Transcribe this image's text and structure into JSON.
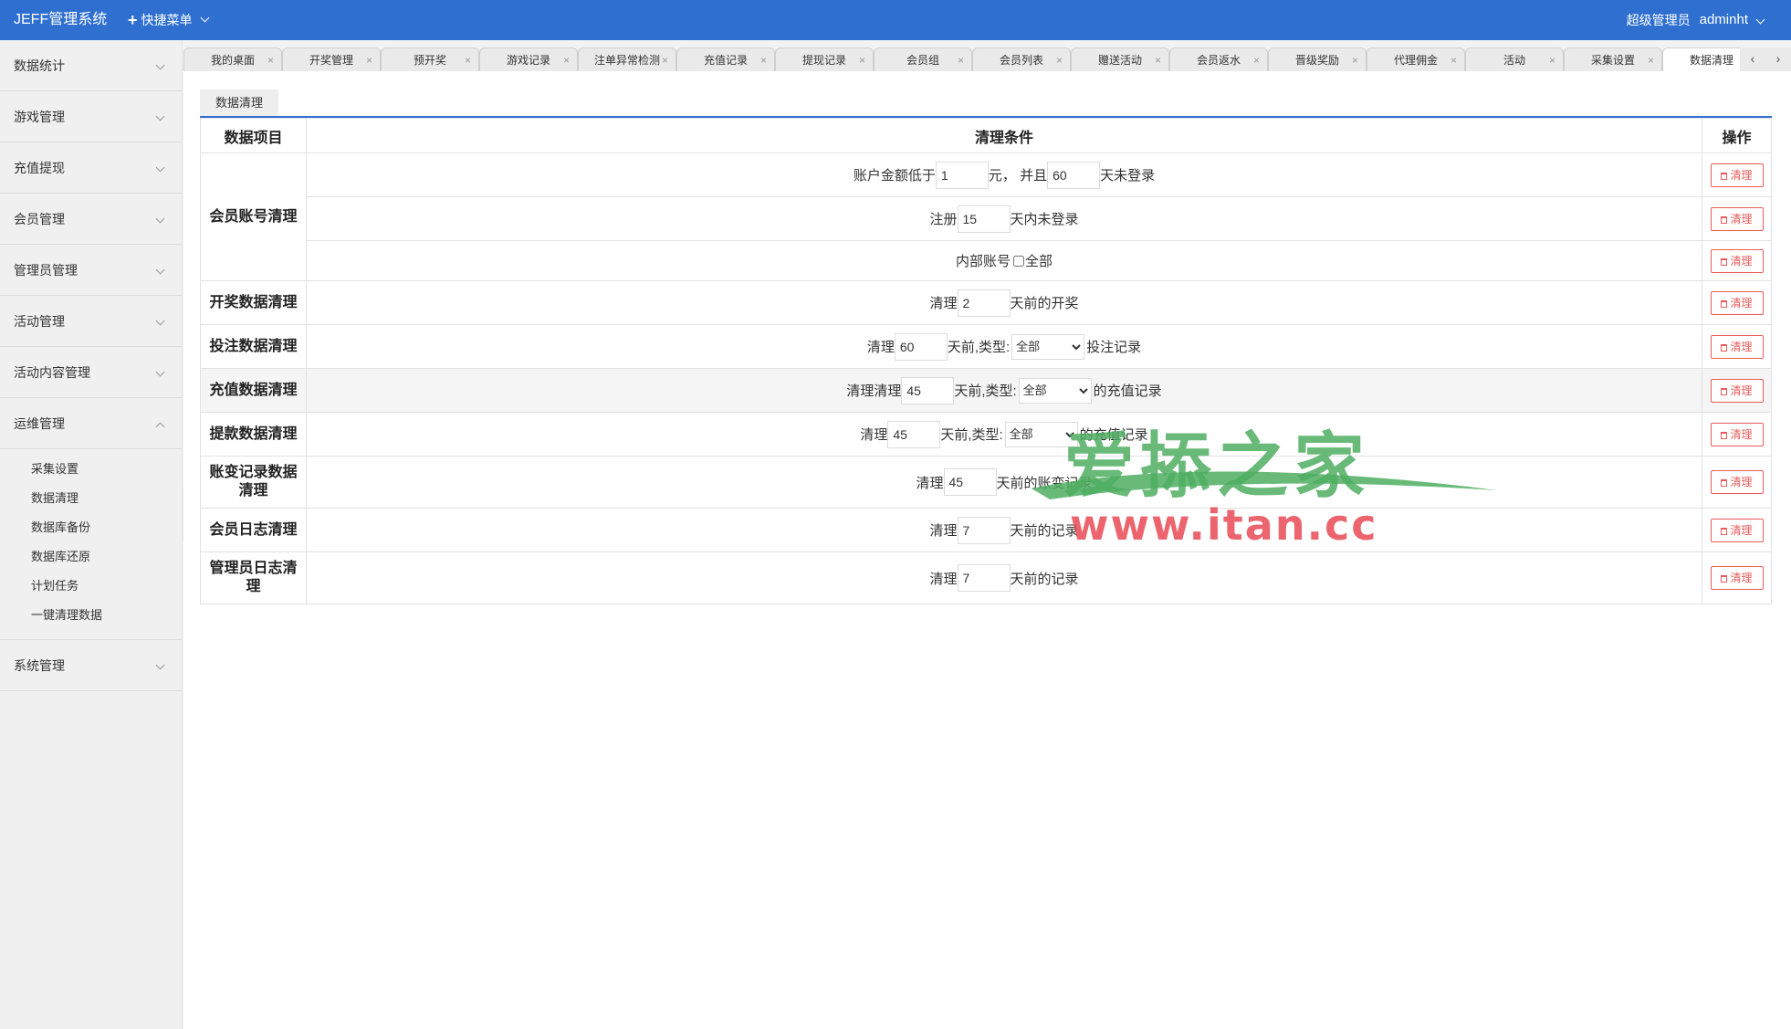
{
  "header": {
    "brand": "JEFF管理系统",
    "quick_menu": "快捷菜单",
    "role": "超级管理员",
    "username": "adminht"
  },
  "sidebar": {
    "groups": [
      {
        "label": "数据统计"
      },
      {
        "label": "游戏管理"
      },
      {
        "label": "充值提现"
      },
      {
        "label": "会员管理"
      },
      {
        "label": "管理员管理"
      },
      {
        "label": "活动管理"
      },
      {
        "label": "活动内容管理"
      },
      {
        "label": "运维管理",
        "open": true
      },
      {
        "label": "系统管理"
      }
    ],
    "ops_sub_items": [
      "采集设置",
      "数据清理",
      "数据库备份",
      "数据库还原",
      "计划任务",
      "一键清理数据"
    ]
  },
  "tabs": [
    {
      "label": "我的桌面"
    },
    {
      "label": "开奖管理"
    },
    {
      "label": "预开奖"
    },
    {
      "label": "游戏记录"
    },
    {
      "label": "注单异常检测"
    },
    {
      "label": "充值记录"
    },
    {
      "label": "提现记录"
    },
    {
      "label": "会员组"
    },
    {
      "label": "会员列表"
    },
    {
      "label": "赠送活动"
    },
    {
      "label": "会员返水"
    },
    {
      "label": "晋级奖励"
    },
    {
      "label": "代理佣金"
    },
    {
      "label": "活动"
    },
    {
      "label": "采集设置"
    },
    {
      "label": "数据清理",
      "active": true
    }
  ],
  "tab_nav": {
    "prev": "‹",
    "next": "›",
    "close": "×"
  },
  "page": {
    "subtab": "数据清理",
    "headers": {
      "item": "数据项目",
      "condition": "清理条件",
      "op": "操作"
    },
    "clean_label": "清理",
    "rows": {
      "member": {
        "label": "会员账号清理",
        "r1": {
          "prefix": "账户金额低于",
          "amount": "1",
          "mid": "元， 并且",
          "days": "60",
          "suffix": "天未登录"
        },
        "r2": {
          "prefix": "注册",
          "days": "15",
          "suffix": "天内未登录"
        },
        "r3": {
          "prefix": "内部账号",
          "suffix": "全部"
        }
      },
      "lottery": {
        "label": "开奖数据清理",
        "prefix": "清理",
        "days": "2",
        "suffix": "天前的开奖"
      },
      "bet": {
        "label": "投注数据清理",
        "prefix": "清理",
        "days": "60",
        "mid": "天前,类型:",
        "type": "全部",
        "suffix": "投注记录"
      },
      "recharge": {
        "label": "充值数据清理",
        "prefix": "清理清理",
        "days": "45",
        "mid": "天前,类型:",
        "type": "全部",
        "suffix": "的充值记录"
      },
      "withdraw": {
        "label": "提款数据清理",
        "prefix": "清理",
        "days": "45",
        "mid": "天前,类型:",
        "type": "全部",
        "suffix": "的充值记录"
      },
      "ledger": {
        "label": "账变记录数据清理",
        "prefix": "清理",
        "days": "45",
        "suffix": "天前的账变记录"
      },
      "member_log": {
        "label": "会员日志清理",
        "prefix": "清理",
        "days": "7",
        "suffix": "天前的记录"
      },
      "admin_log": {
        "label": "管理员日志清理",
        "prefix": "清理",
        "days": "7",
        "suffix": "天前的记录"
      }
    },
    "type_options": [
      "全部"
    ]
  },
  "watermark": {
    "text": "爱掭之家",
    "url": "www.itan.cc"
  },
  "colors": {
    "header_bg": "#2f6fd0",
    "accent": "#2f6fd0",
    "danger": "#ea5a5a",
    "watermark_green": "#4fae62",
    "watermark_red": "#e94b55"
  }
}
